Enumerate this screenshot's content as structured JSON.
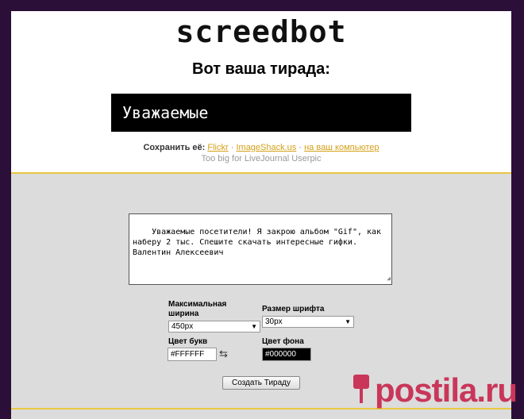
{
  "site": {
    "logo": "screedbot"
  },
  "result": {
    "heading": "Вот ваша тирада:",
    "banner_text": "Уважаемые"
  },
  "save": {
    "prefix": "Сохранить её:",
    "links": [
      "Flickr",
      "ImageShack.us",
      "на ваш компьютер"
    ],
    "separator": "·",
    "note": "Too big for LiveJournal Userpic"
  },
  "form": {
    "text_value": "Уважаемые посетители! Я закрою альбом \"Gif\", как наберу 2 тыс. Спешите скачать интересные гифки. Валентин Алексеевич",
    "max_width_label": "Максимальная ширина",
    "max_width_value": "450px",
    "font_size_label": "Размер шрифта",
    "font_size_value": "30px",
    "text_color_label": "Цвет букв",
    "text_color_value": "#FFFFFF",
    "bg_color_label": "Цвет фона",
    "bg_color_value": "#000000",
    "swap_icon": "⇆",
    "submit_label": "Создать Тираду"
  },
  "watermark": {
    "text": "postila.ru"
  },
  "colors": {
    "outer_bg": "#2b0f38",
    "link": "#d4a017",
    "divider": "#e8c840",
    "watermark": "#c9365a"
  }
}
